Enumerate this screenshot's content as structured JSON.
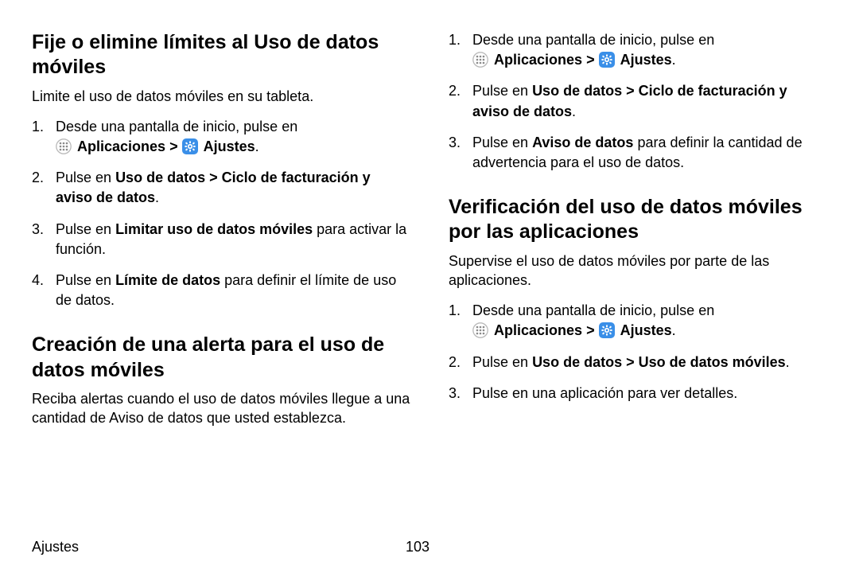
{
  "common": {
    "step_home": "Desde una pantalla de inicio, pulse en ",
    "aplicaciones": "Aplicaciones",
    "ajustes": "Ajustes",
    "chevron": " > ",
    "dot": "."
  },
  "left": {
    "h1": "Fije o elimine límites al Uso de datos móviles",
    "intro1": "Limite el uso de datos móviles en su tableta.",
    "s1": {
      "step2_a": "Pulse en ",
      "step2_b": "Uso de datos > Ciclo de facturación y aviso de datos",
      "step3_a": "Pulse en ",
      "step3_b": "Limitar uso de datos móviles",
      "step3_c": " para activar la función.",
      "step4_a": "Pulse en ",
      "step4_b": "Límite de datos",
      "step4_c": " para definir el límite de uso de datos."
    },
    "h2": "Creación de una alerta para el uso de datos móviles",
    "intro2": "Reciba alertas cuando el uso de datos móviles llegue a una cantidad de Aviso de datos que usted establezca."
  },
  "right": {
    "s1": {
      "step2_a": "Pulse en ",
      "step2_b": "Uso de datos > Ciclo de facturación y aviso de datos",
      "step3_a": "Pulse en ",
      "step3_b": "Aviso de datos",
      "step3_c": " para definir la cantidad de advertencia para el uso de datos."
    },
    "h1": "Verificación del uso de datos móviles por las aplicaciones",
    "intro1": "Supervise el uso de datos móviles por parte de las aplicaciones.",
    "s2": {
      "step2_a": "Pulse en ",
      "step2_b": "Uso de datos > Uso de datos móviles",
      "step3": "Pulse en una aplicación para ver detalles."
    }
  },
  "footer": {
    "section": "Ajustes",
    "page": "103"
  }
}
